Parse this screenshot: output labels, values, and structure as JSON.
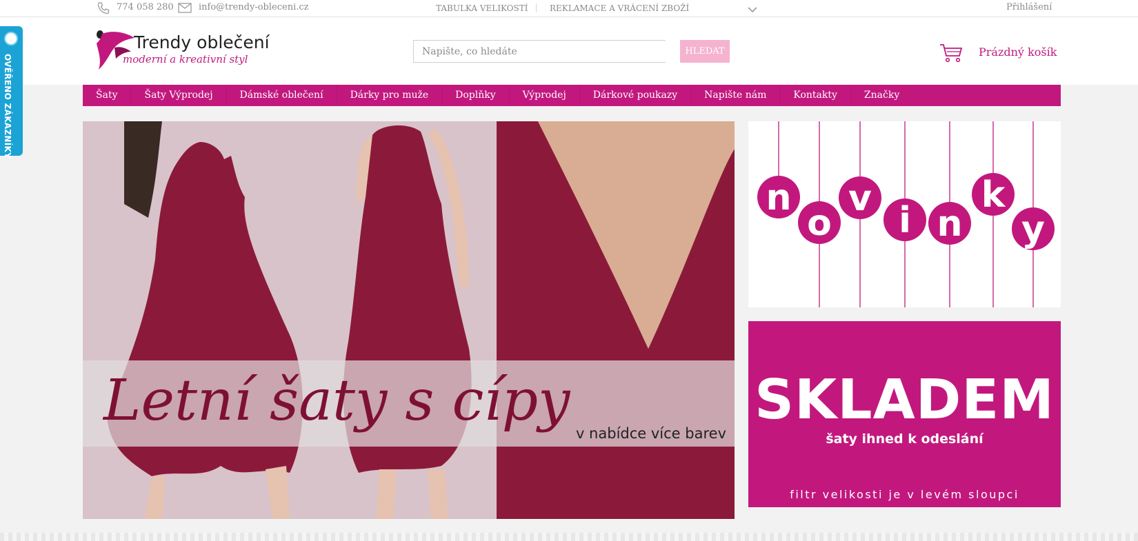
{
  "topbar": {
    "phone": "774 058 280",
    "email": "info@trendy-obleceni.cz",
    "links": [
      "TABULKA VELIKOSTÍ",
      "REKLAMACE A VRÁCENÍ ZBOŽÍ"
    ],
    "login": "Přihlášení"
  },
  "header": {
    "logo_title": "Trendy oblečení",
    "logo_subtitle": "moderní a kreativní styl",
    "search_placeholder": "Napište, co hledáte",
    "search_button": "HLEDAT",
    "cart_label": "Prázdný košík"
  },
  "nav": [
    "Šaty",
    "Šaty Výprodej",
    "Dámské oblečení",
    "Dárky pro muže",
    "Doplňky",
    "Výprodej",
    "Dárkové poukazy",
    "Napište nám",
    "Kontakty",
    "Značky"
  ],
  "badge": {
    "text": "OVĚŘENO ZÁKAZNÍKY"
  },
  "hero": {
    "title": "Letní šaty s cípy",
    "subtitle": "v nabídce více barev"
  },
  "novinky": {
    "letters": [
      "n",
      "o",
      "v",
      "i",
      "n",
      "k",
      "y"
    ]
  },
  "skladem": {
    "title": "SKLADEM",
    "subtitle": "šaty ihned k odeslání",
    "note": "filtr velikosti je v levém sloupci"
  },
  "colors": {
    "accent": "#c2187e",
    "search_button": "#f5b3cf",
    "badge": "#1ba3d6",
    "hero_dress": "#8b1a3a"
  },
  "icons": [
    "phone-icon",
    "mail-icon",
    "chevron-down-icon",
    "cart-icon",
    "verified-icon"
  ]
}
